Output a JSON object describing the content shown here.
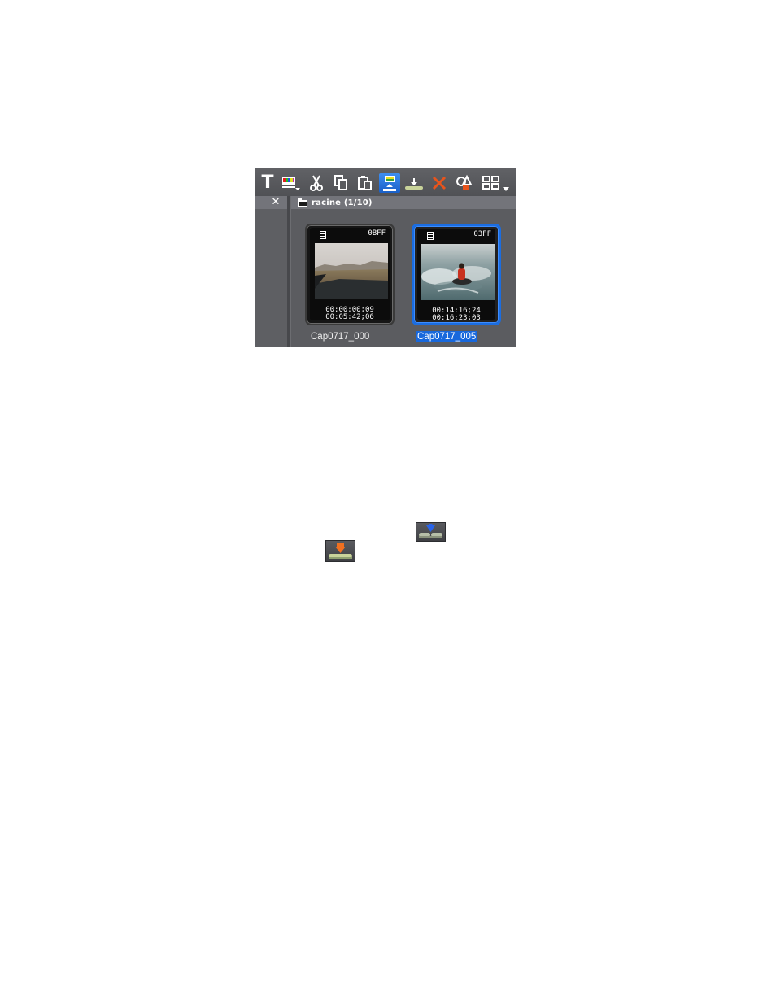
{
  "toolbar": {
    "text_tool_glyph": "T",
    "buttons": [
      {
        "name": "text-tool",
        "icon": "text-icon"
      },
      {
        "name": "color-bars",
        "icon": "color-bars-icon"
      },
      {
        "name": "cut",
        "icon": "scissors-icon"
      },
      {
        "name": "copy",
        "icon": "copy-icon"
      },
      {
        "name": "paste",
        "icon": "paste-icon"
      },
      {
        "name": "send-to-timeline",
        "icon": "send-to-timeline-icon",
        "active": true
      },
      {
        "name": "insert-to-timeline",
        "icon": "insert-icon"
      },
      {
        "name": "delete",
        "icon": "delete-x-icon"
      },
      {
        "name": "properties",
        "icon": "properties-icon"
      },
      {
        "name": "view-mode",
        "icon": "grid-view-icon"
      }
    ]
  },
  "left_pane": {
    "close_glyph": "✕"
  },
  "bin": {
    "title": "racine (1/10)",
    "clips": [
      {
        "code": "0BFF",
        "timecode_in": "00:00:00;09",
        "timecode_out": "00:05:42;06",
        "name": "Cap0717_000",
        "selected": false
      },
      {
        "code": "03FF",
        "timecode_in": "00:14:16;24",
        "timecode_out": "00:16:23;03",
        "name": "Cap0717_005",
        "selected": true
      }
    ]
  },
  "colors": {
    "panel_bg": "#5b5c60",
    "header_bg": "#73747a",
    "selection_blue": "#1868dc",
    "delete_orange": "#e8541c"
  }
}
